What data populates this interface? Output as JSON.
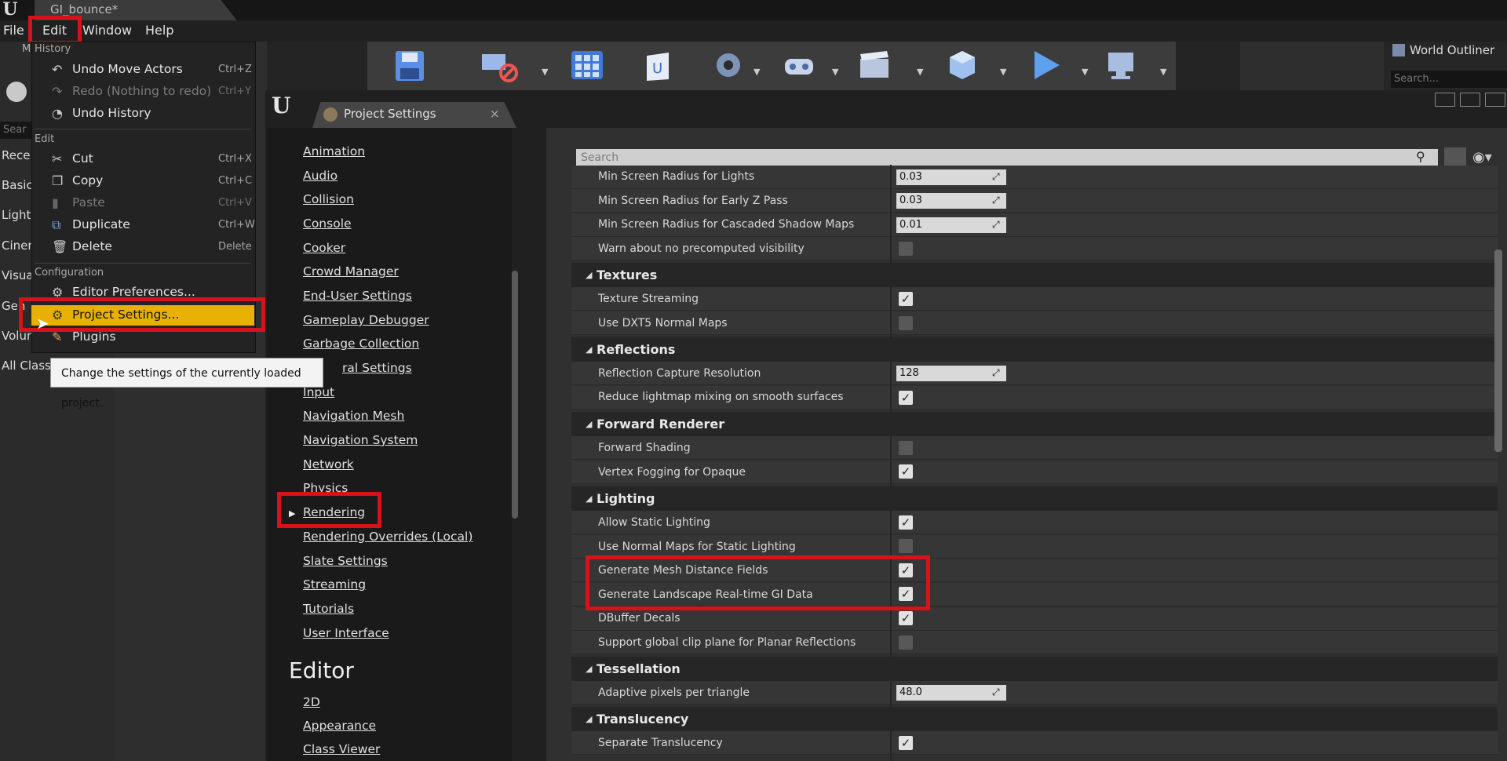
{
  "document_tab": "GI_bounce*",
  "menubar": {
    "file": "File",
    "edit": "Edit",
    "window": "Window",
    "help": "Help"
  },
  "left_panel": {
    "search_placeholder": "Sear",
    "categories": [
      "Rece",
      "Basic",
      "Light",
      "Cinen",
      "Visua",
      "Gen",
      "Volun",
      "All Class"
    ]
  },
  "world_outliner": {
    "title": "World Outliner",
    "search_placeholder": "Search..."
  },
  "toolbar": {
    "icons": [
      "save-icon",
      "source-control-icon",
      "content-icon",
      "marketplace-icon",
      "settings-icon",
      "blueprints-icon",
      "cinematics-icon",
      "build-icon",
      "play-icon",
      "launch-icon"
    ]
  },
  "edit_menu": {
    "history_header": "History",
    "history_partial": "M",
    "undo": {
      "label": "Undo Move Actors",
      "shortcut": "Ctrl+Z"
    },
    "redo": {
      "label": "Redo (Nothing to redo)",
      "shortcut": "Ctrl+Y"
    },
    "undo_history": "Undo History",
    "edit_header": "Edit",
    "cut": {
      "label": "Cut",
      "shortcut": "Ctrl+X"
    },
    "copy": {
      "label": "Copy",
      "shortcut": "Ctrl+C"
    },
    "paste": {
      "label": "Paste",
      "shortcut": "Ctrl+V"
    },
    "duplicate": {
      "label": "Duplicate",
      "shortcut": "Ctrl+W"
    },
    "delete": {
      "label": "Delete",
      "shortcut": "Delete"
    },
    "config_header": "Configuration",
    "editor_prefs": "Editor Preferences...",
    "project_settings": "Project Settings...",
    "plugins": "Plugins",
    "tooltip": "Change the settings of the currently loaded project."
  },
  "project_settings": {
    "tab_label": "Project Settings",
    "tab_close": "×",
    "nav_items": [
      "Animation",
      "Audio",
      "Collision",
      "Console",
      "Cooker",
      "Crowd Manager",
      "End-User Settings",
      "Gameplay Debugger",
      "Garbage Collection",
      "ral Settings",
      "Input",
      "Navigation Mesh",
      "Navigation System",
      "Network",
      "Physics",
      "Rendering",
      "Rendering Overrides (Local)",
      "Slate Settings",
      "Streaming",
      "Tutorials",
      "User Interface"
    ],
    "nav_selected": "Rendering",
    "editor_header": "Editor",
    "editor_items": [
      "2D",
      "Appearance",
      "Class Viewer"
    ],
    "search_placeholder": "Search"
  },
  "settings_rows": {
    "min_radius_lights": {
      "label": "Min Screen Radius for Lights",
      "value": "0.03"
    },
    "min_radius_early_z": {
      "label": "Min Screen Radius for Early Z Pass",
      "value": "0.03"
    },
    "min_radius_csm": {
      "label": "Min Screen Radius for Cascaded Shadow Maps",
      "value": "0.01"
    },
    "warn_precomputed": {
      "label": "Warn about no precomputed visibility",
      "checked": false
    },
    "textures_header": "Textures",
    "texture_streaming": {
      "label": "Texture Streaming",
      "checked": true
    },
    "dxt5_normal": {
      "label": "Use DXT5 Normal Maps",
      "checked": false
    },
    "reflections_header": "Reflections",
    "reflection_capture": {
      "label": "Reflection Capture Resolution",
      "value": "128"
    },
    "reduce_lightmap": {
      "label": "Reduce lightmap mixing on smooth surfaces",
      "checked": true
    },
    "forward_header": "Forward Renderer",
    "forward_shading": {
      "label": "Forward Shading",
      "checked": false
    },
    "vertex_fogging": {
      "label": "Vertex Fogging for Opaque",
      "checked": true
    },
    "lighting_header": "Lighting",
    "allow_static": {
      "label": "Allow Static Lighting",
      "checked": true
    },
    "normal_maps_static": {
      "label": "Use Normal Maps for Static Lighting",
      "checked": false
    },
    "mesh_distance": {
      "label": "Generate Mesh Distance Fields",
      "checked": true
    },
    "landscape_gi": {
      "label": "Generate Landscape Real-time GI Data",
      "checked": true
    },
    "dbuffer": {
      "label": "DBuffer Decals",
      "checked": true
    },
    "clip_plane": {
      "label": "Support global clip plane for Planar Reflections",
      "checked": false
    },
    "tessellation_header": "Tessellation",
    "adaptive_pixels": {
      "label": "Adaptive pixels per triangle",
      "value": "48.0"
    },
    "translucency_header": "Translucency",
    "separate_translucency": {
      "label": "Separate Translucency",
      "checked": true
    }
  },
  "colors": {
    "highlight": "#e7b003",
    "annotation_red": "#d8121b"
  }
}
